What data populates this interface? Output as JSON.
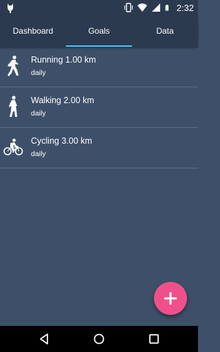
{
  "status_bar": {
    "time": "2:32",
    "icons": [
      "notification-icon",
      "vibrate-icon",
      "wifi-icon",
      "signal-icon",
      "battery-icon"
    ]
  },
  "tabs": [
    {
      "label": "Dashboard",
      "selected": false
    },
    {
      "label": "Goals",
      "selected": true
    },
    {
      "label": "Data",
      "selected": false
    }
  ],
  "goals": [
    {
      "title": "Running 1.00 km",
      "period": "daily",
      "icon": "running-icon"
    },
    {
      "title": "Walking 2.00 km",
      "period": "daily",
      "icon": "walking-icon"
    },
    {
      "title": "Cycling 3.00 km",
      "period": "daily",
      "icon": "cycling-icon"
    }
  ],
  "fab": {
    "icon": "plus-icon"
  },
  "nav_bar": {
    "icons": [
      "back-icon",
      "home-icon",
      "recents-icon"
    ]
  },
  "colors": {
    "background": "#3e5069",
    "app_bar": "#2b3a4f",
    "tab_indicator": "#4fc3f7",
    "fab": "#f0508a",
    "divider": "#5c6d84"
  }
}
